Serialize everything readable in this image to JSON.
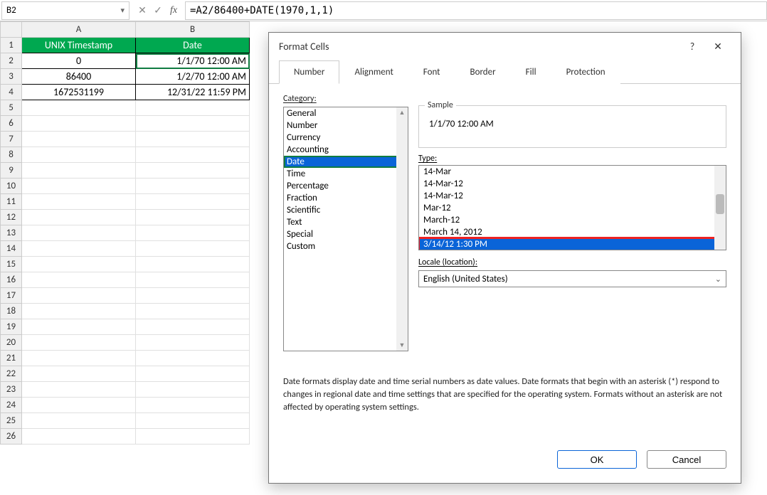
{
  "namebox": "B2",
  "formula": "=A2/86400+DATE(1970,1,1)",
  "columns": [
    "A",
    "B"
  ],
  "rows": [
    "1",
    "2",
    "3",
    "4",
    "5",
    "6",
    "7",
    "8",
    "9",
    "10",
    "11",
    "12",
    "13",
    "14",
    "15",
    "16",
    "17",
    "18",
    "19",
    "20",
    "21",
    "22",
    "23",
    "24",
    "25",
    "26"
  ],
  "grid": {
    "headers": {
      "A": "UNIX Timestamp",
      "B": "Date"
    },
    "data": [
      {
        "A": "0",
        "B": "1/1/70 12:00 AM"
      },
      {
        "A": "86400",
        "B": "1/2/70 12:00 AM"
      },
      {
        "A": "1672531199",
        "B": "12/31/22 11:59 PM"
      }
    ]
  },
  "dialog": {
    "title": "Format Cells",
    "tabs": [
      "Number",
      "Alignment",
      "Font",
      "Border",
      "Fill",
      "Protection"
    ],
    "active_tab": "Number",
    "category_label": "Category:",
    "categories": [
      "General",
      "Number",
      "Currency",
      "Accounting",
      "Date",
      "Time",
      "Percentage",
      "Fraction",
      "Scientific",
      "Text",
      "Special",
      "Custom"
    ],
    "category_selected": "Date",
    "sample_label": "Sample",
    "sample_value": "1/1/70 12:00 AM",
    "type_label": "Type:",
    "types": [
      "14-Mar",
      "14-Mar-12",
      "14-Mar-12",
      "Mar-12",
      "March-12",
      "March 14, 2012",
      "3/14/12 1:30 PM"
    ],
    "type_selected": "3/14/12 1:30 PM",
    "locale_label": "Locale (location):",
    "locale_value": "English (United States)",
    "description": "Date formats display date and time serial numbers as date values.  Date formats that begin with an asterisk (*) respond to changes in regional date and time settings that are specified for the operating system. Formats without an asterisk are not affected by operating system settings.",
    "ok": "OK",
    "cancel": "Cancel"
  }
}
